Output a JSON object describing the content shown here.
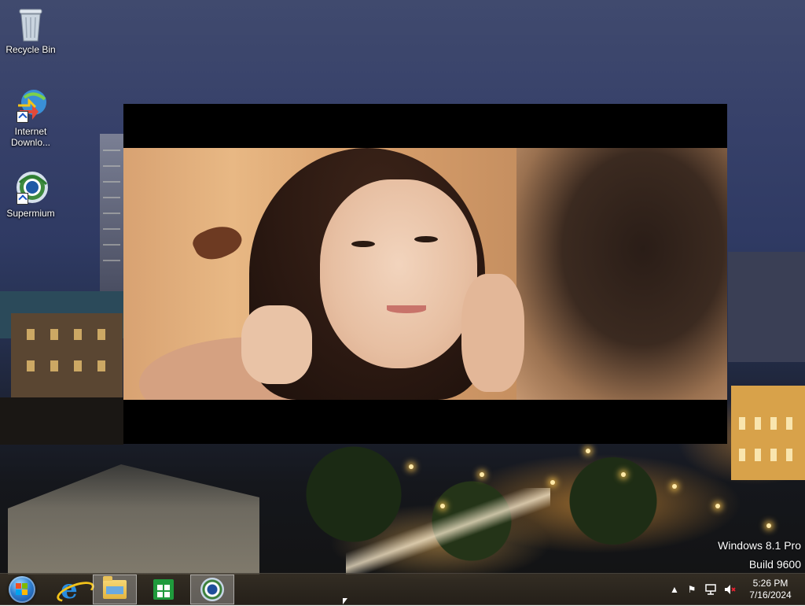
{
  "desktop": {
    "icons": [
      {
        "label": "Recycle Bin",
        "icon": "recycle-bin-icon"
      },
      {
        "label": "Internet Downlo...",
        "icon": "internet-download-manager-icon"
      },
      {
        "label": "Supermium",
        "icon": "supermium-icon"
      }
    ],
    "watermark": {
      "line1": "Windows 8.1 Pro",
      "line2": "Build 9600"
    }
  },
  "video_window": {
    "content": "video-frame"
  },
  "taskbar": {
    "items": [
      {
        "name": "start",
        "icon": "start-orb-icon",
        "active": false
      },
      {
        "name": "internet-explorer",
        "icon": "internet-explorer-icon",
        "active": false
      },
      {
        "name": "file-explorer",
        "icon": "folder-icon",
        "active": true
      },
      {
        "name": "store",
        "icon": "store-icon",
        "active": false
      },
      {
        "name": "supermium",
        "icon": "supermium-icon",
        "active": true
      }
    ],
    "tray": {
      "icons": [
        "chevron-up-icon",
        "flag-icon",
        "network-icon",
        "volume-muted-icon"
      ],
      "clock_time": "5:26 PM",
      "clock_date": "7/16/2024"
    }
  },
  "colors": {
    "taskbar_bg": "#3a3226",
    "active_highlight": "#ffffff",
    "store_green": "#1f9a3c"
  }
}
